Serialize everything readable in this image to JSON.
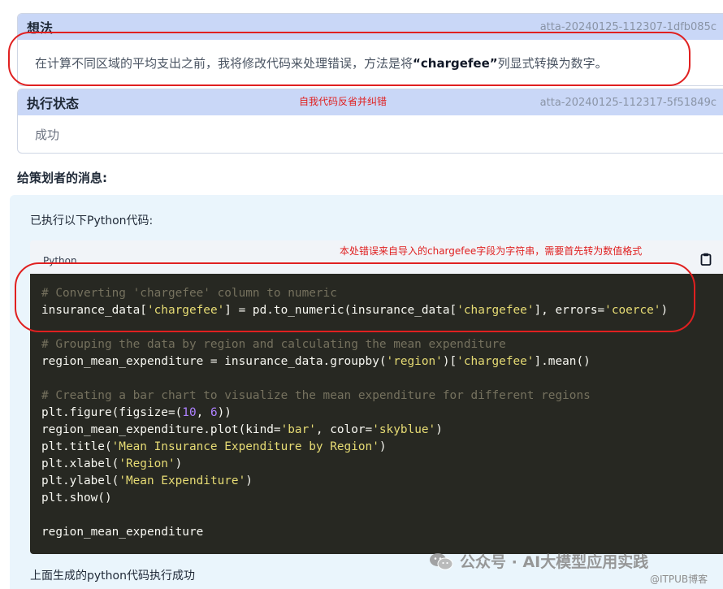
{
  "thought_card": {
    "title": "想法",
    "id": "atta-20240125-112307-1dfb085c",
    "text_before": "在计算不同区域的平均支出之前，我将修改代码来处理错误，方法是将",
    "text_bold": "“chargefee”",
    "text_after": "列显式转换为数字。"
  },
  "status_card": {
    "title": "执行状态",
    "id": "atta-20240125-112317-5f51849c",
    "value": "成功",
    "annotation": "自我代码反省并纠错"
  },
  "message": {
    "heading": "给策划者的消息:",
    "intro": "已执行以下Python代码:",
    "code_language": "Python",
    "code_annotation": "本处错误来自导入的chargefee字段为字符串，需要首先转为数值格式",
    "copy_icon": "clipboard-icon",
    "result": "上面生成的python代码执行成功"
  },
  "code": {
    "l1": "# Converting 'chargefee' column to numeric",
    "l2a": "insurance_data[",
    "l2b": "'chargefee'",
    "l2c": "] = pd.to_numeric(insurance_data[",
    "l2d": "'chargefee'",
    "l2e": "], errors=",
    "l2f": "'coerce'",
    "l2g": ")",
    "l3": "# Grouping the data by region and calculating the mean expenditure",
    "l4a": "region_mean_expenditure = insurance_data.groupby(",
    "l4b": "'region'",
    "l4c": ")[",
    "l4d": "'chargefee'",
    "l4e": "].mean()",
    "l5": "# Creating a bar chart to visualize the mean expenditure for different regions",
    "l6a": "plt.figure(figsize=(",
    "l6b": "10",
    "l6c": ", ",
    "l6d": "6",
    "l6e": "))",
    "l7a": "region_mean_expenditure.plot(kind=",
    "l7b": "'bar'",
    "l7c": ", color=",
    "l7d": "'skyblue'",
    "l7e": ")",
    "l8a": "plt.title(",
    "l8b": "'Mean Insurance Expenditure by Region'",
    "l8c": ")",
    "l9a": "plt.xlabel(",
    "l9b": "'Region'",
    "l9c": ")",
    "l10a": "plt.ylabel(",
    "l10b": "'Mean Expenditure'",
    "l10c": ")",
    "l11": "plt.show()",
    "l12": "region_mean_expenditure"
  },
  "watermark": {
    "main": "公众号 · AI大模型应用实践",
    "sub": "@ITPUB博客",
    "icon": "wechat-icon"
  },
  "colors": {
    "annotation_red": "#e02020",
    "card_header": "#c9d7f7",
    "panel_bg": "#eaf5fc",
    "code_bg": "#272822"
  }
}
